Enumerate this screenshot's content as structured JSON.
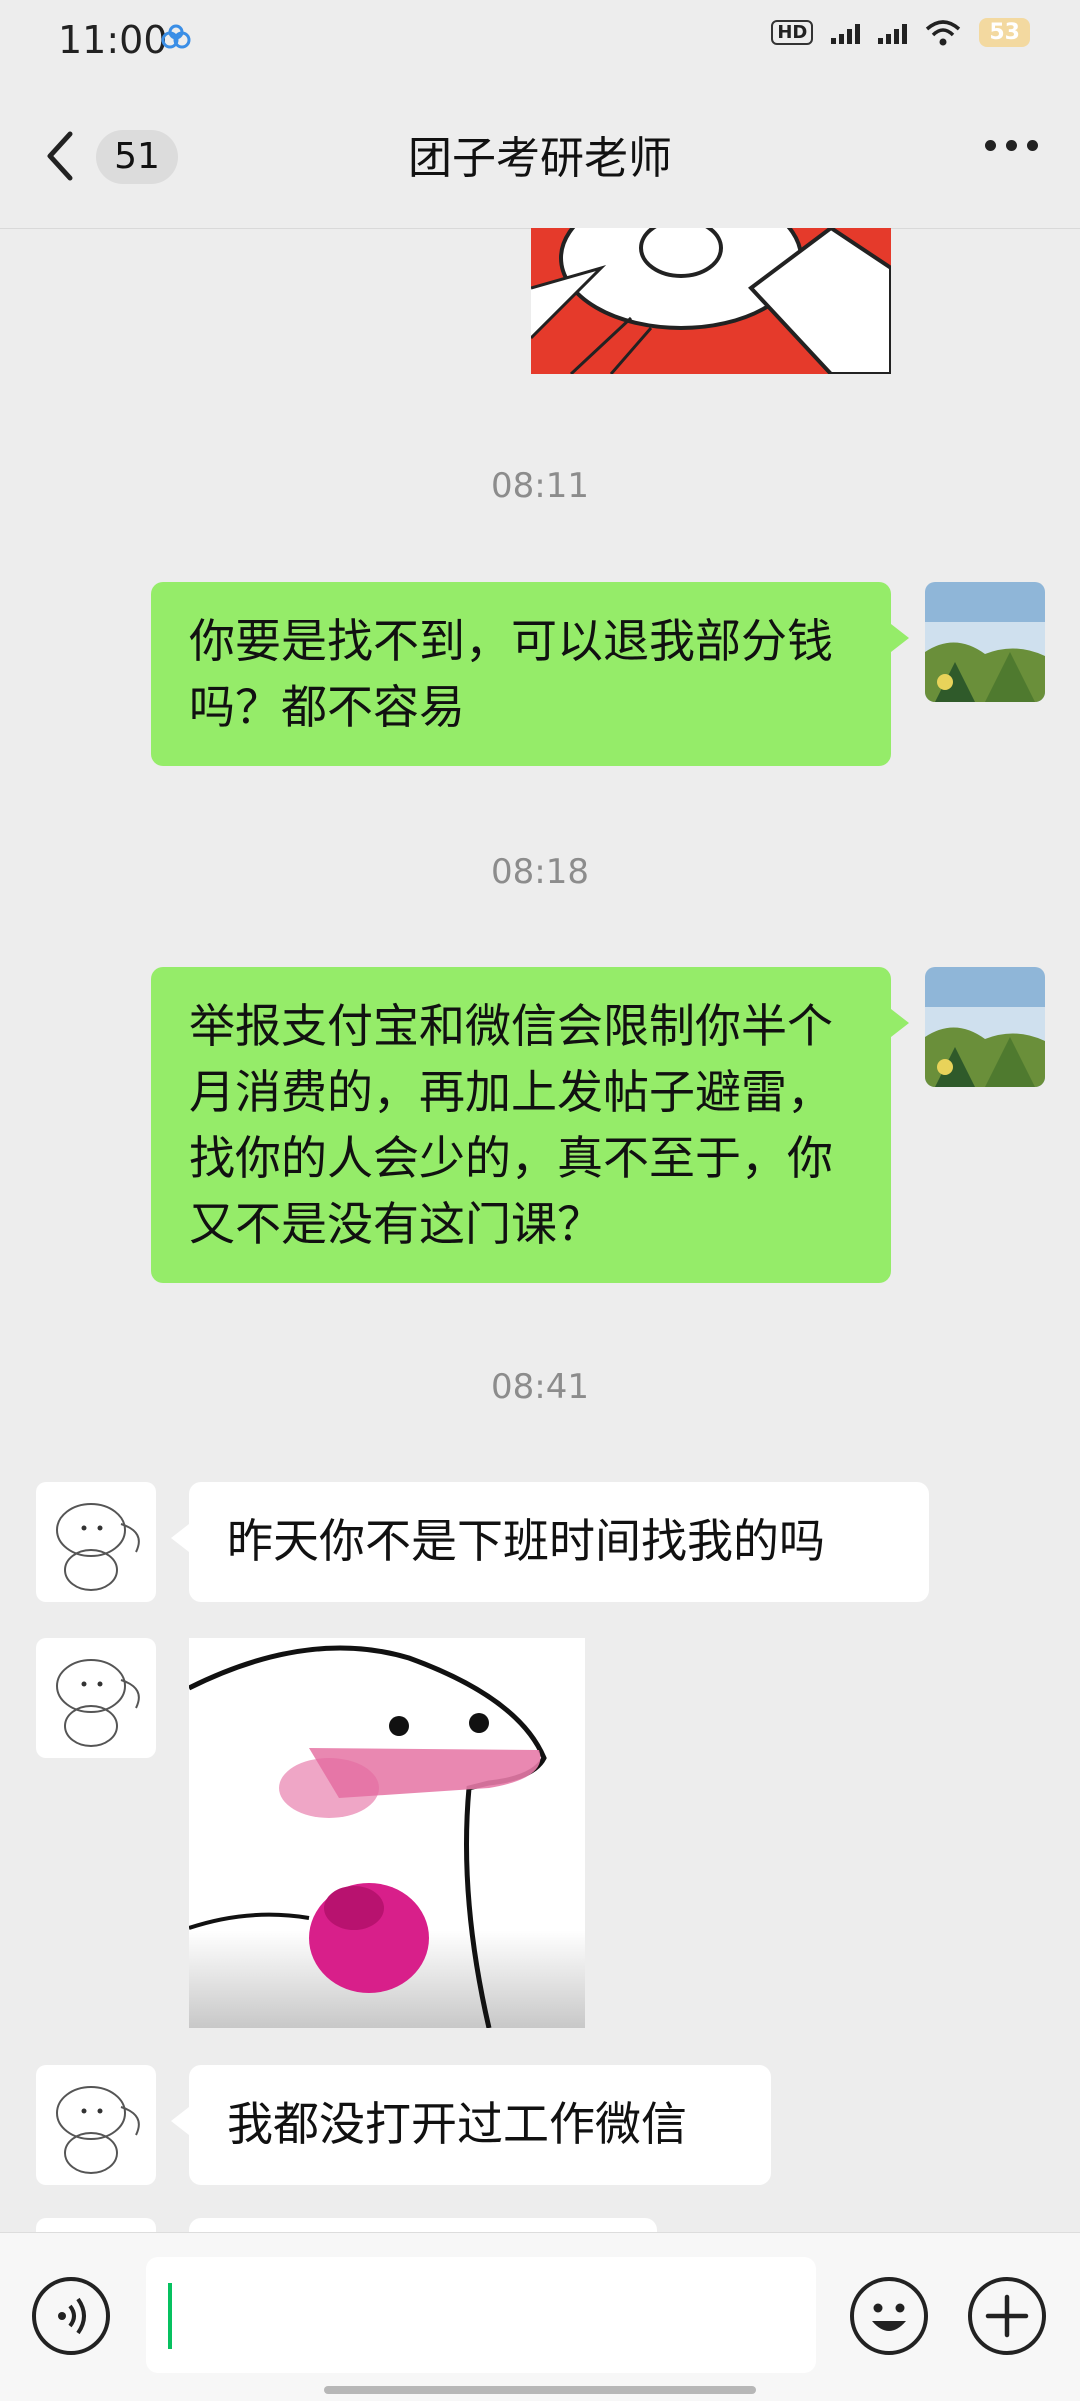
{
  "status_bar": {
    "time": "11:00",
    "battery": "53"
  },
  "header": {
    "unread_count": "51",
    "title": "团子考研老师"
  },
  "messages": [
    {
      "type": "timestamp",
      "text": "08:11"
    },
    {
      "type": "text",
      "side": "right",
      "text": "你要是找不到，可以退我部分钱吗？都不容易"
    },
    {
      "type": "timestamp",
      "text": "08:18"
    },
    {
      "type": "text",
      "side": "right",
      "text": "举报支付宝和微信会限制你半个月消费的，再加上发帖子避雷，找你的人会少的，真不至于，你又不是没有这门课？"
    },
    {
      "type": "timestamp",
      "text": "08:41"
    },
    {
      "type": "text",
      "side": "left",
      "text": "昨天你不是下班时间找我的吗"
    },
    {
      "type": "sticker",
      "side": "left"
    },
    {
      "type": "text",
      "side": "left",
      "text": "我都没打开过工作微信"
    }
  ],
  "input": {
    "value": ""
  },
  "colors": {
    "my_bubble": "#95ec69",
    "their_bubble": "#ffffff",
    "background": "#ededed",
    "cursor": "#07c160"
  }
}
